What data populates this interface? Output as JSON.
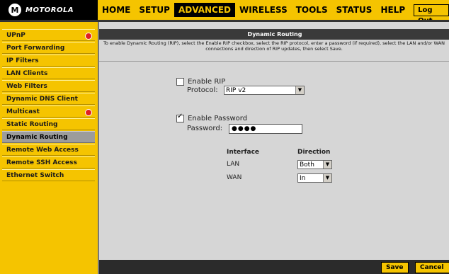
{
  "brand": {
    "name": "MOTOROLA"
  },
  "nav": {
    "items": [
      "HOME",
      "SETUP",
      "ADVANCED",
      "WIRELESS",
      "TOOLS",
      "STATUS",
      "HELP"
    ],
    "active": "ADVANCED",
    "logout_label": "Log Out"
  },
  "sidebar": {
    "items": [
      {
        "label": "UPnP",
        "badge": true
      },
      {
        "label": "Port Forwarding",
        "badge": false
      },
      {
        "label": "IP Filters",
        "badge": false
      },
      {
        "label": "LAN Clients",
        "badge": false
      },
      {
        "label": "Web Filters",
        "badge": false
      },
      {
        "label": "Dynamic DNS Client",
        "badge": false
      },
      {
        "label": "Multicast",
        "badge": true
      },
      {
        "label": "Static Routing",
        "badge": false
      },
      {
        "label": "Dynamic Routing",
        "badge": false,
        "active": true
      },
      {
        "label": "Remote Web Access",
        "badge": false
      },
      {
        "label": "Remote SSH Access",
        "badge": false
      },
      {
        "label": "Ethernet Switch",
        "badge": false
      }
    ]
  },
  "main": {
    "title": "Dynamic Routing",
    "description": "To enable Dynamic Routing (RIP), select the Enable RIP checkbox, select the RIP protocol, enter a password (if required), select the LAN and/or WAN connections and direction of RIP updates, then select Save.",
    "enable_rip": {
      "label": "Enable RIP",
      "checked": false
    },
    "protocol": {
      "label": "Protocol:",
      "value": "RIP v2"
    },
    "enable_password": {
      "label": "Enable Password",
      "checked": true
    },
    "password": {
      "label": "Password:",
      "value": "●●●●"
    },
    "table": {
      "headers": [
        "Interface",
        "Direction"
      ],
      "rows": [
        {
          "interface": "LAN",
          "direction": "Both"
        },
        {
          "interface": "WAN",
          "direction": "In"
        }
      ]
    },
    "buttons": {
      "save": "Save",
      "cancel": "Cancel"
    }
  },
  "colors": {
    "accent": "#f5c400",
    "sidebar_active": "#9c9c9c",
    "content_bg": "#d6d6d6",
    "title_bar": "#3a3a3a"
  }
}
